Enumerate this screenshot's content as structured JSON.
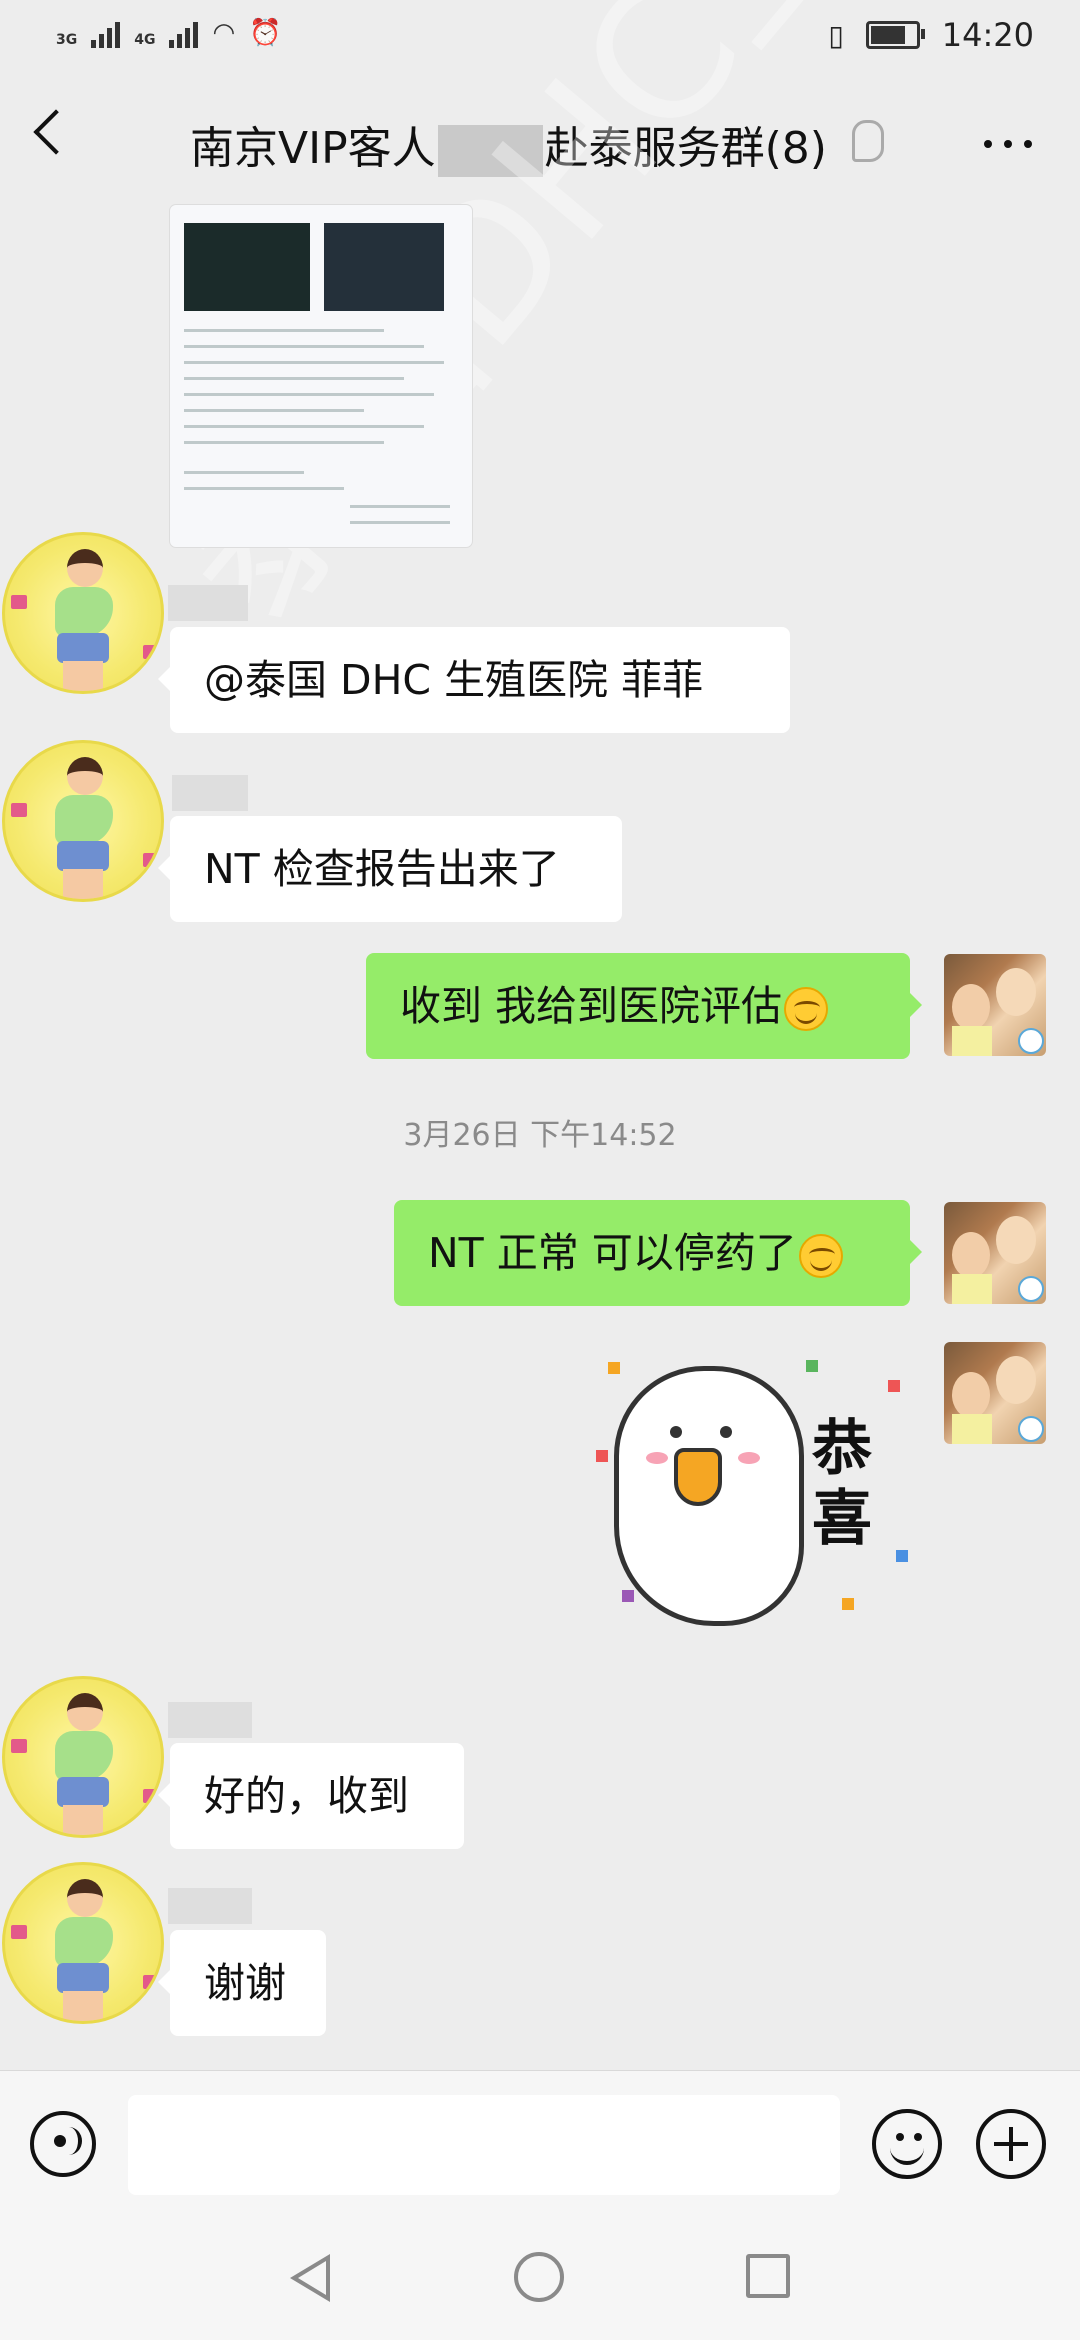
{
  "status_bar": {
    "network_1": "3G",
    "network_2": "4G",
    "time": "14:20"
  },
  "header": {
    "title_part1": "南京VIP客人",
    "title_part2": "赴泰服务群(8)"
  },
  "messages": [
    {
      "side": "left",
      "type": "text",
      "text": "@泰国 DHC 生殖医院  菲菲"
    },
    {
      "side": "left",
      "type": "text",
      "text": "NT 检查报告出来了"
    },
    {
      "side": "right",
      "type": "text",
      "text": "收到 我给到医院评估"
    },
    {
      "side": "right",
      "type": "text",
      "text": "NT 正常 可以停药了"
    },
    {
      "side": "left",
      "type": "text",
      "text": "好的，收到"
    },
    {
      "side": "left",
      "type": "text",
      "text": "谢谢"
    }
  ],
  "timestamp": "3月26日 下午14:52",
  "sticker": {
    "text_top": "恭",
    "text_bottom": "喜"
  },
  "watermark": "泰国DHC生殖医院",
  "icons": {
    "back": "back-arrow-icon",
    "more": "more-dots-icon",
    "voice": "voice-icon",
    "emoji": "emoji-icon",
    "plus": "plus-icon"
  },
  "colors": {
    "background": "#ededed",
    "right_bubble": "#95ec69",
    "left_bubble": "#ffffff"
  }
}
